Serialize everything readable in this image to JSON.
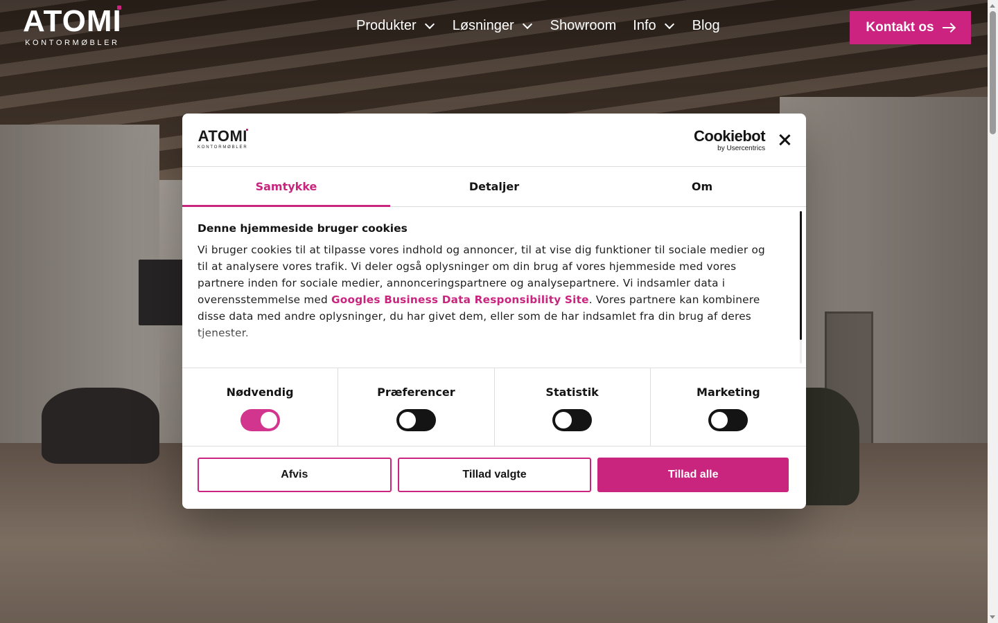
{
  "header": {
    "brand": {
      "word": "ATOMI",
      "sub": "KONTORMØBLER"
    },
    "nav": [
      {
        "label": "Produkter",
        "dropdown": true
      },
      {
        "label": "Løsninger",
        "dropdown": true
      },
      {
        "label": "Showroom",
        "dropdown": false
      },
      {
        "label": "Info",
        "dropdown": true
      },
      {
        "label": "Blog",
        "dropdown": false
      }
    ],
    "cta_label": "Kontakt os"
  },
  "dialog": {
    "logo": {
      "word": "ATOMI",
      "sub": "KONTORMØBLER"
    },
    "cookiebot": {
      "word": "Cookiebot",
      "sub": "by Usercentrics"
    },
    "tabs": [
      {
        "label": "Samtykke",
        "active": true
      },
      {
        "label": "Detaljer",
        "active": false
      },
      {
        "label": "Om",
        "active": false
      }
    ],
    "body": {
      "title": "Denne hjemmeside bruger cookies",
      "text_before": "Vi bruger cookies til at tilpasse vores indhold og annoncer, til at vise dig funktioner til sociale medier og til at analysere vores trafik. Vi deler også oplysninger om din brug af vores hjemmeside med vores partnere inden for sociale medier, annonceringspartnere og analysepartnere. Vi indsamler data i overensstemmelse med ",
      "link": "Googles Business Data Responsibility Site",
      "text_after": ". Vores partnere kan kombinere disse data med andre oplysninger, du har givet dem, eller som de har indsamlet fra din brug af deres tjenester."
    },
    "preferences": [
      {
        "label": "Nødvendig",
        "enabled": true
      },
      {
        "label": "Præferencer",
        "enabled": false
      },
      {
        "label": "Statistik",
        "enabled": false
      },
      {
        "label": "Marketing",
        "enabled": false
      }
    ],
    "buttons": {
      "reject": "Afvis",
      "allow_selected": "Tillad valgte",
      "allow_all": "Tillad alle"
    }
  },
  "colors": {
    "accent": "#c9257f",
    "toggle_on": "#d2358d",
    "toggle_off": "#141414"
  }
}
